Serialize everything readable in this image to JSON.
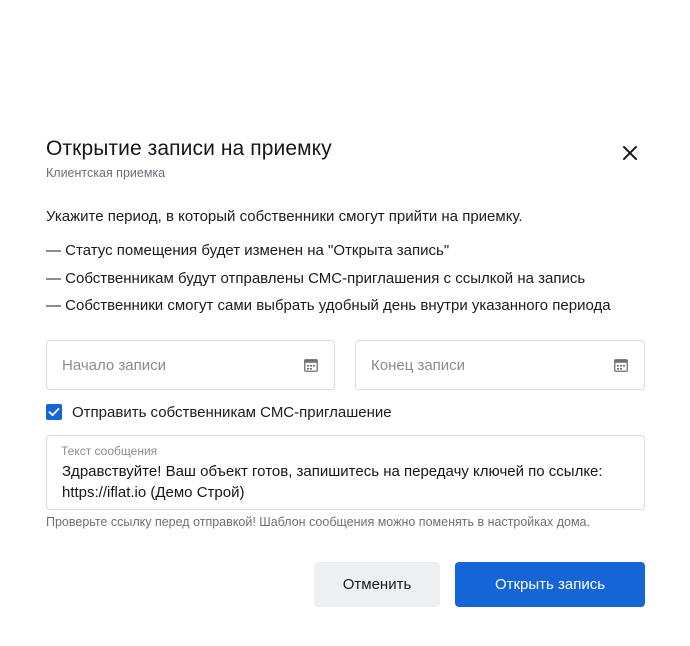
{
  "dialog": {
    "title": "Открытие записи на приемку",
    "subtitle": "Клиентская приемка",
    "close_icon": "close-icon",
    "intro": "Укажите период, в который собственники смогут прийти на приемку.",
    "bullets": [
      "— Статус помещения будет изменен на \"Открыта запись\"",
      "— Собственникам будут отправлены СМС-приглашения с ссылкой на запись",
      "— Собственники смогут сами выбрать удобный день внутри указанного периода"
    ],
    "start_date": {
      "placeholder": "Начало записи",
      "value": "",
      "icon": "calendar-icon"
    },
    "end_date": {
      "placeholder": "Конец записи",
      "value": "",
      "icon": "calendar-icon"
    },
    "sms_checkbox": {
      "label": "Отправить собственникам СМС-приглашение",
      "checked": true
    },
    "message": {
      "label": "Текст сообщения",
      "value": "Здравствуйте! Ваш объект готов, запишитесь на передачу ключей по ссылке:\nhttps://iflat.io (Демо Строй)"
    },
    "hint": "Проверьте ссылку перед отправкой! Шаблон сообщения можно поменять в настройках дома.",
    "buttons": {
      "cancel_label": "Отменить",
      "submit_label": "Открыть запись"
    }
  },
  "colors": {
    "accent": "#1565d8",
    "cancel_bg": "#eeeff1",
    "border": "#d9dbe1",
    "muted_text": "#6d6f78"
  }
}
